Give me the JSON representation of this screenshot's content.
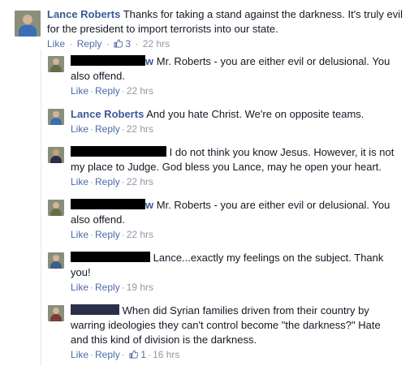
{
  "top_comment": {
    "author": "Lance Roberts",
    "text": "Thanks for taking a stand against the darkness. It's truly evil for the president to import terrorists into our state.",
    "like": "Like",
    "reply": "Reply",
    "likes_count": "3",
    "time": "22 hrs"
  },
  "replies": [
    {
      "author_visible": "w",
      "text": "Mr. Roberts - you are either evil or delusional. You also offend.",
      "like": "Like",
      "reply": "Reply",
      "time": "22 hrs"
    },
    {
      "author_visible": "Lance Roberts",
      "text": "And you hate Christ. We're on opposite teams.",
      "like": "Like",
      "reply": "Reply",
      "time": "22 hrs"
    },
    {
      "author_visible": "",
      "text": "I do not think you know Jesus. However, it is not my place to Judge. God bless you Lance, may he open your heart.",
      "like": "Like",
      "reply": "Reply",
      "time": "22 hrs"
    },
    {
      "author_visible": "w",
      "text": "Mr. Roberts - you are either evil or delusional. You also offend.",
      "like": "Like",
      "reply": "Reply",
      "time": "22 hrs"
    },
    {
      "author_visible": "",
      "text": "Lance...exactly my feelings on the subject. Thank you!",
      "like": "Like",
      "reply": "Reply",
      "time": "19 hrs"
    },
    {
      "author_visible": "",
      "text": "When did Syrian families driven from their country by warring ideologies they can't control become \"the darkness?\" Hate and this kind of division is the darkness.",
      "like": "Like",
      "reply": "Reply",
      "likes_count": "1",
      "time": "16 hrs"
    }
  ],
  "colors": {
    "link": "#3b5998",
    "action": "#4e6aa6",
    "meta": "#9197a3",
    "text": "#141823"
  }
}
